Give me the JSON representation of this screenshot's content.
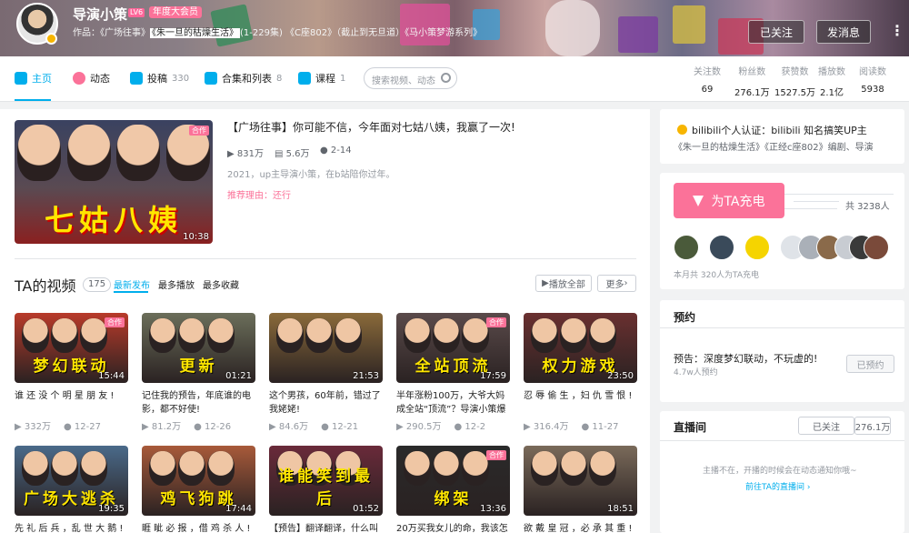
{
  "header": {
    "username": "导演小策",
    "level": "LV6",
    "vip_badge": "年度大会员",
    "works": [
      {
        "text": "作品：《广场往事》",
        "highlight": false
      },
      {
        "text": "《朱一旦的枯燥生活》",
        "highlight": true
      },
      {
        "text": "(1-229集) 《C座802》（截止到无旦道）《马小策梦游系列》",
        "highlight": false
      }
    ],
    "follow_label": "已关注",
    "message_label": "发消息",
    "more_icon": "⋮"
  },
  "nav": {
    "items": [
      {
        "label": "主页",
        "count": "",
        "icon": "home-icon"
      },
      {
        "label": "动态",
        "count": "",
        "icon": "dynamic-icon"
      },
      {
        "label": "投稿",
        "count": "330",
        "icon": "upload-icon"
      },
      {
        "label": "合集和列表",
        "count": "8",
        "icon": "collection-icon"
      },
      {
        "label": "课程",
        "count": "1",
        "icon": "course-icon"
      }
    ],
    "search_placeholder": "搜索视频、动态",
    "stats": [
      {
        "label": "关注数",
        "value": "69"
      },
      {
        "label": "粉丝数",
        "value": "276.1万"
      },
      {
        "label": "获赞数",
        "value": "1527.5万"
      },
      {
        "label": "播放数",
        "value": "2.1亿"
      },
      {
        "label": "阅读数",
        "value": "5938"
      }
    ]
  },
  "featured": {
    "thumb_text": "七姑八姨",
    "tag": "合作",
    "duration": "10:38",
    "title": "【广场往事】你可能不信，今年面对七姑八姨，我赢了一次!",
    "plays": "831万",
    "danmaku": "5.6万",
    "date": "2-14",
    "desc": "2021，up主导演小策，在b站陪你过年。",
    "recommend": "推荐理由：还行"
  },
  "videos_section": {
    "title": "TA的视频",
    "count": "175",
    "sorts": [
      "最新发布",
      "最多播放",
      "最多收藏"
    ],
    "play_all": "播放全部",
    "more": "更多"
  },
  "videos": [
    {
      "thumb_text": "梦幻联动",
      "tag": "合作",
      "duration": "15:44",
      "title": "谁 还 没 个 明 星 朋 友 !",
      "plays": "332万",
      "date": "12-27",
      "bg": "#b83a2a"
    },
    {
      "thumb_text": "更新",
      "tag": "",
      "duration": "01:21",
      "title": "记住我的预告，年底谁的电影，都不好使!",
      "plays": "81.2万",
      "date": "12-26",
      "bg": "#6b6e5a"
    },
    {
      "thumb_text": "",
      "tag": "",
      "duration": "21:53",
      "title": "这个男孩，60年前，错过了我姥姥!",
      "plays": "84.6万",
      "date": "12-21",
      "bg": "#8a6a3a"
    },
    {
      "thumb_text": "全站顶流",
      "tag": "合作",
      "duration": "17:59",
      "title": "半年涨粉100万，大爷大妈成全站“顶流”？导演小策爆款",
      "plays": "290.5万",
      "date": "12-2",
      "bg": "#5a4a4a"
    },
    {
      "thumb_text": "权力游戏",
      "tag": "",
      "duration": "23:50",
      "title": "忍 辱 偷 生 ，妇 仇 雪 恨 !",
      "plays": "316.4万",
      "date": "11-27",
      "bg": "#6a3030"
    },
    {
      "thumb_text": "广场大逃杀",
      "tag": "",
      "duration": "19:35",
      "title": "先 礼 后 兵 ，乱 世 大 鹅 !",
      "plays": "",
      "date": "",
      "bg": "#4a6a8a"
    },
    {
      "thumb_text": "鸡飞狗跳",
      "tag": "",
      "duration": "17:44",
      "title": "睚 眦 必 报 ，借 鸡 杀 人 !",
      "plays": "",
      "date": "",
      "bg": "#a85a3a"
    },
    {
      "thumb_text": "谁能笑到最后",
      "tag": "",
      "duration": "01:52",
      "title": "【预告】翻译翻译，什么叫潇",
      "plays": "",
      "date": "",
      "bg": "#6a2a3a"
    },
    {
      "thumb_text": "绑架",
      "tag": "合作",
      "duration": "13:36",
      "title": "20万买我女儿的命，我该怎么",
      "plays": "",
      "date": "",
      "bg": "#2a2a2a"
    },
    {
      "thumb_text": "",
      "tag": "",
      "duration": "18:51",
      "title": "欲 戴 皇 冠 ，必 承 其 重 !",
      "plays": "",
      "date": "",
      "bg": "#7a6a5a"
    }
  ],
  "sidebar": {
    "cert_text": "bilibili个人认证：bilibili 知名搞笑UP主",
    "cert_sub": "《朱一旦的枯燥生活》《正经c座802》编剧、导演",
    "charge_button": "为TA充电",
    "charge_total": "共 3238人",
    "charge_month": "本月共 320人为TA充电",
    "fan_colors": [
      "#4a5a3a",
      "#3a4a5a",
      "#f5d400",
      "#dfe3e8",
      "#aab0b8",
      "#8a6a4a",
      "#c8ccd2",
      "#3a3a3a",
      "#7a4a3a"
    ],
    "reserve_title": "预约",
    "reserve_text": "预告：深度梦幻联动，不玩虚的!",
    "reserve_count": "4.7w人预约",
    "reserve_button": "已预约",
    "live_title": "直播间",
    "live_follow": "已关注",
    "live_fans": "276.1万",
    "live_status": "主播不在，开播的时候会在动态通知你哦~",
    "live_link": "前往TA的直播间"
  },
  "colors": {
    "accent": "#00aeec",
    "pink": "#fb7299",
    "muted": "#9499a0"
  }
}
